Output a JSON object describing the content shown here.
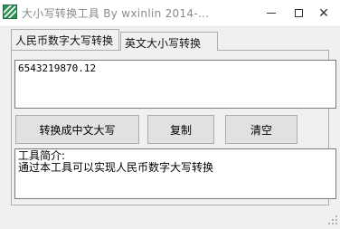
{
  "window": {
    "title": "大小写转换工具  By   wxinlin    2014-...",
    "minimize_glyph": "",
    "close_glyph": "✕"
  },
  "tabs": [
    {
      "label": "人民币数字大写转换",
      "active": true
    },
    {
      "label": "英文大小写转换",
      "active": false
    }
  ],
  "input": {
    "value": "6543219870.12"
  },
  "buttons": {
    "convert_label": "转换成中文大写",
    "copy_label": "复制",
    "clear_label": "清空"
  },
  "info": {
    "heading": "工具简介:",
    "text": "通过本工具可以实现人民币数字大写转换"
  },
  "icons": {
    "app": "app-logo-icon",
    "minimize": "minimize-icon",
    "maximize": "maximize-icon",
    "close": "close-icon",
    "grip": "resize-grip-icon"
  },
  "colors": {
    "app_icon": "#2e8f57",
    "title_text": "#8a8a8a",
    "button_face": "#e1e1e1",
    "window_bg": "#f0f0f0"
  }
}
